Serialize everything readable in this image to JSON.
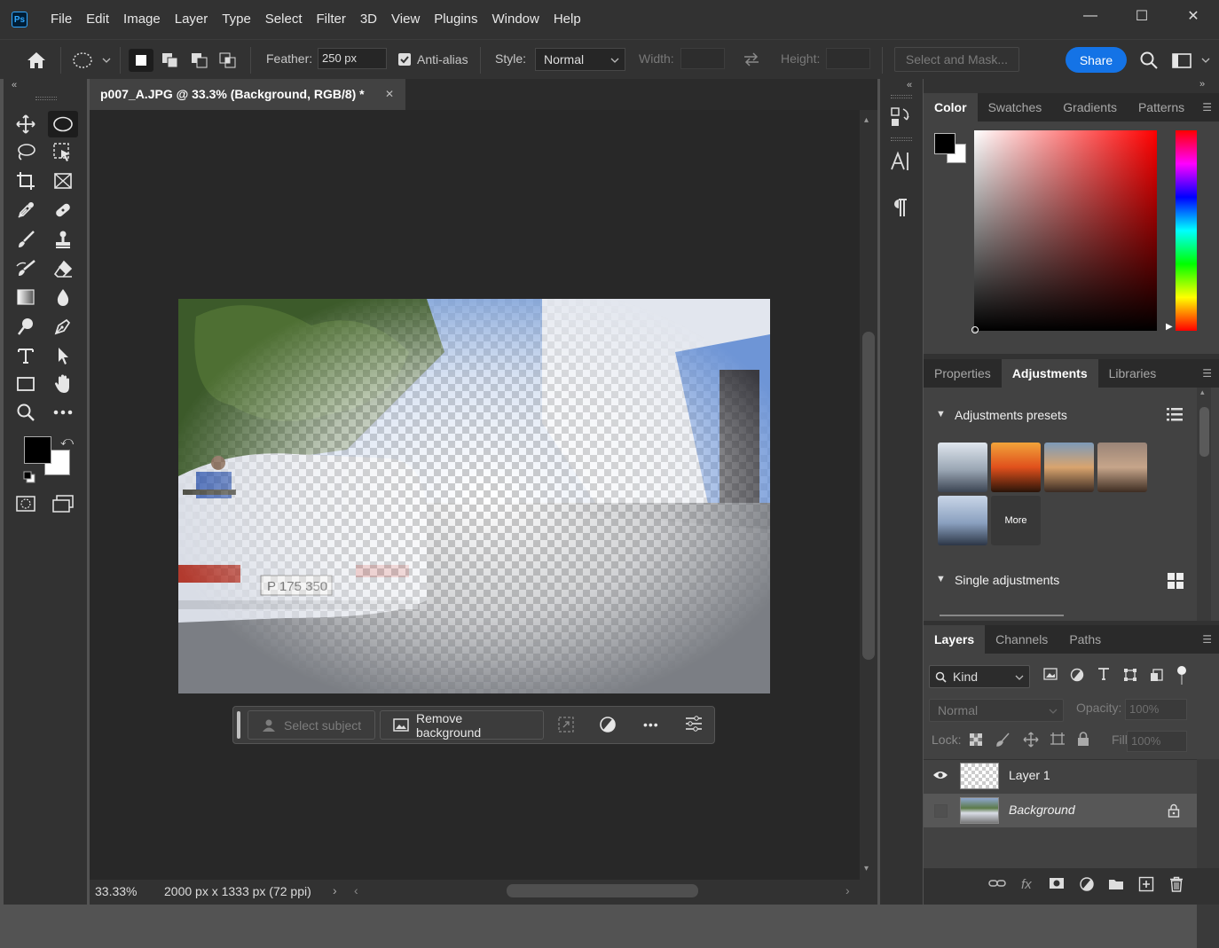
{
  "app": {
    "logo": "Ps",
    "menu": [
      "File",
      "Edit",
      "Image",
      "Layer",
      "Type",
      "Select",
      "Filter",
      "3D",
      "View",
      "Plugins",
      "Window",
      "Help"
    ],
    "window_controls": [
      "—",
      "☐",
      "✕"
    ]
  },
  "options_bar": {
    "feather_label": "Feather:",
    "feather_value": "250 px",
    "antialias_label": "Anti-alias",
    "antialias_checked": true,
    "style_label": "Style:",
    "style_value": "Normal",
    "width_label": "Width:",
    "height_label": "Height:",
    "select_mask_label": "Select and Mask...",
    "share_label": "Share"
  },
  "document": {
    "tab_title": "p007_A.JPG @ 33.3% (Background, RGB/8) *",
    "close_glyph": "✕",
    "zoom": "33.33%",
    "doc_info": "2000 px x 1333 px (72 ppi)",
    "plate_text": "P 175 350"
  },
  "context_bar": {
    "select_subject": "Select subject",
    "remove_background": "Remove background",
    "more": "•••"
  },
  "panels": {
    "color_tabs": [
      "Color",
      "Swatches",
      "Gradients",
      "Patterns"
    ],
    "adjust_tabs": [
      "Properties",
      "Adjustments",
      "Libraries"
    ],
    "presets_title": "Adjustments presets",
    "more_label": "More",
    "single_title": "Single adjustments",
    "layers_tabs": [
      "Layers",
      "Channels",
      "Paths"
    ],
    "kind_label": "Kind",
    "blend_mode": "Normal",
    "opacity_label": "Opacity:",
    "opacity_value": "100%",
    "lock_label": "Lock:",
    "fill_label": "Fill:",
    "fill_value": "100%",
    "layers": [
      {
        "name": "Layer 1",
        "visible": true
      },
      {
        "name": "Background",
        "visible": false,
        "locked": true
      }
    ]
  },
  "colors": {
    "accent": "#1473e6",
    "foreground": "#000000",
    "background": "#ffffff"
  }
}
